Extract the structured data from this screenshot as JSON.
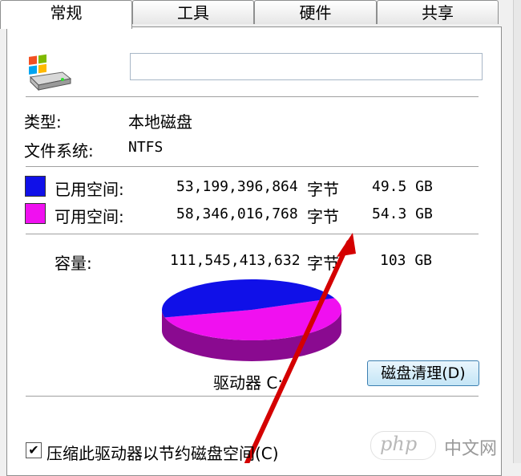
{
  "tabs": [
    {
      "label": "常规",
      "active": true
    },
    {
      "label": "工具",
      "active": false
    },
    {
      "label": "硬件",
      "active": false
    },
    {
      "label": "共享",
      "active": false
    }
  ],
  "drive_icon": "drive-windows-icon",
  "name_field": {
    "value": ""
  },
  "type": {
    "label": "类型:",
    "value": "本地磁盘"
  },
  "filesystem": {
    "label": "文件系统:",
    "value": "NTFS"
  },
  "used": {
    "label": "已用空间:",
    "bytes": "53,199,396,864",
    "unit": "字节",
    "size": "49.5 GB",
    "color": "#1010e8"
  },
  "free": {
    "label": "可用空间:",
    "bytes": "58,346,016,768",
    "unit": "字节",
    "size": "54.3 GB",
    "color": "#f010f0"
  },
  "capacity": {
    "label": "容量:",
    "bytes": "111,545,413,632",
    "unit": "字节",
    "size": "103 GB"
  },
  "drive_label": "驱动器 C:",
  "cleanup_button": "磁盘清理(D)",
  "compress_checkbox": {
    "label": "压缩此驱动器以节约磁盘空间(C)",
    "checked": true
  },
  "watermark": {
    "logo": "php",
    "text": "中文网"
  },
  "pie": {
    "used_fraction": 0.477,
    "free_fraction": 0.523,
    "used_dark": "#0a0a90",
    "free_dark": "#8a0a90"
  }
}
